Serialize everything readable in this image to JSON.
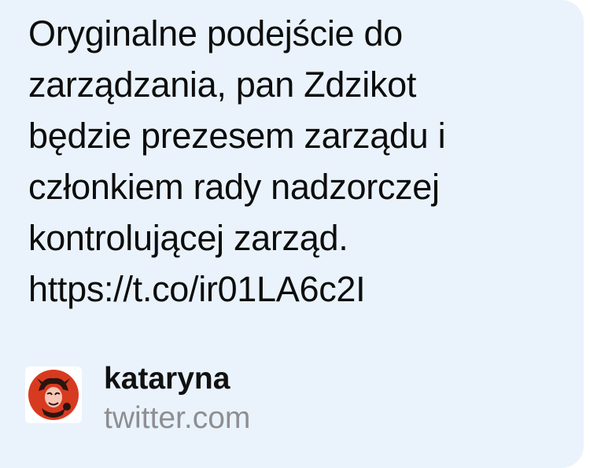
{
  "tweet": {
    "text": "Oryginalne podejście do\nzarządzania, pan Zdzikot\nbędzie prezesem zarządu i\nczłonkiem rady nadzorczej\nkontrolującej zarząd.\nhttps://t.co/ir01LA6c2I"
  },
  "link_preview": {
    "title": "kataryna",
    "domain": "twitter.com",
    "avatar_icon": "jester-avatar-icon"
  },
  "colors": {
    "card_background": "#eaf3fc",
    "text": "#0d0d0d",
    "domain_text": "#8e8e93",
    "avatar_red": "#d83a1f"
  }
}
